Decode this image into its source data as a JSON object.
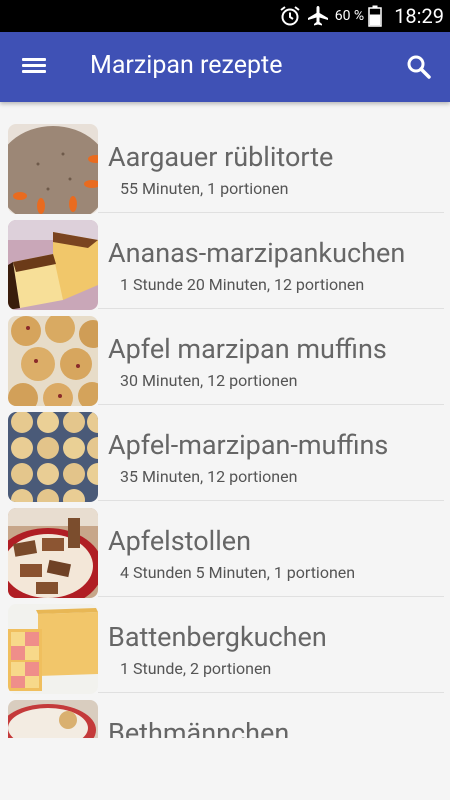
{
  "status_bar": {
    "battery_percent": "60 %",
    "time": "18:29",
    "icons": [
      "alarm-icon",
      "airplane-mode-icon",
      "battery-icon"
    ]
  },
  "app_bar": {
    "title": "Marzipan rezepte",
    "icons": [
      "menu-icon",
      "search-icon"
    ],
    "color": "#3f51b5"
  },
  "recipes": [
    {
      "name": "Aargauer rüblitorte",
      "meta": "55 Minuten, 1 portionen"
    },
    {
      "name": "Ananas-marzipankuchen",
      "meta": "1 Stunde 20 Minuten, 12 portionen"
    },
    {
      "name": "Apfel marzipan muffins",
      "meta": "30 Minuten, 12 portionen"
    },
    {
      "name": "Apfel-marzipan-muffins",
      "meta": "35 Minuten, 12 portionen"
    },
    {
      "name": "Apfelstollen",
      "meta": "4 Stunden 5 Minuten, 1 portionen"
    },
    {
      "name": "Battenbergkuchen",
      "meta": "1 Stunde, 2 portionen"
    },
    {
      "name": "Bethmännchen",
      "meta": ""
    }
  ]
}
